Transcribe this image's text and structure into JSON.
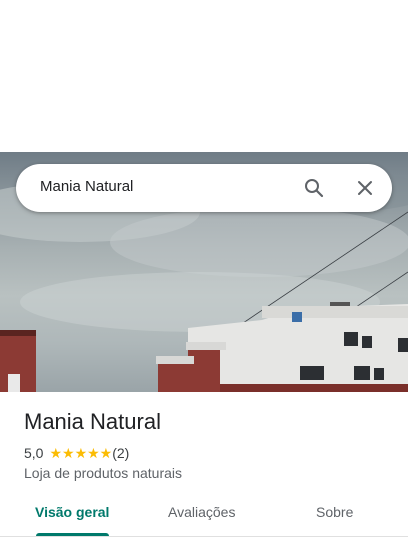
{
  "search": {
    "query": "Mania Natural"
  },
  "place": {
    "name": "Mania Natural",
    "rating": "5,0",
    "stars": "★★★★★",
    "review_count": "(2)",
    "category": "Loja de produtos naturais"
  },
  "tabs": [
    {
      "label": "Visão geral",
      "active": true
    },
    {
      "label": "Avaliações",
      "active": false
    },
    {
      "label": "Sobre",
      "active": false
    }
  ],
  "colors": {
    "accent": "#00796b",
    "star": "#fbbc04"
  },
  "icons": {
    "search": "search-icon",
    "close": "close-icon"
  }
}
